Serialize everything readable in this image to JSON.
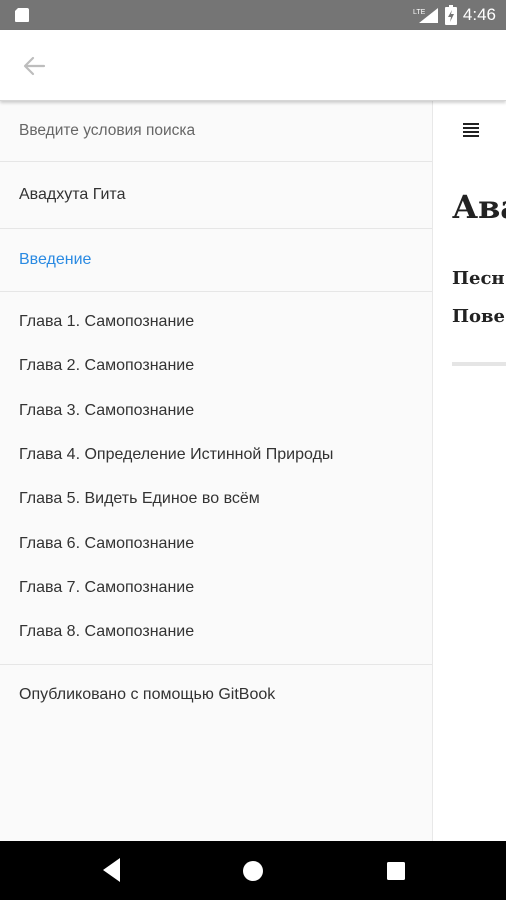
{
  "status_bar": {
    "time": "4:46",
    "network": "LTE",
    "icons": [
      "sd-card-icon",
      "lte-signal-icon",
      "battery-charging-icon"
    ]
  },
  "app_bar": {
    "back_icon": "arrow-back-icon"
  },
  "sidebar": {
    "search_placeholder": "Введите условия поиска",
    "book_title": "Авадхута Гита",
    "active_item": "Введение",
    "chapters": [
      "Глава 1. Самопознание",
      "Глава 2. Самопознание",
      "Глава 3. Самопознание",
      "Глава 4. Определение Истинной Природы",
      "Глава 5. Видеть Единое во всём",
      "Глава 6. Самопознание",
      "Глава 7. Самопознание",
      "Глава 8. Самопознание"
    ],
    "footer": "Опубликовано с помощью GitBook"
  },
  "content": {
    "title": "Ава",
    "line1": "Песн",
    "line2": "Пове"
  },
  "colors": {
    "status_bar": "#757575",
    "accent": "#2a8ae2",
    "sidebar_bg": "#fafafa",
    "text": "#333333"
  }
}
